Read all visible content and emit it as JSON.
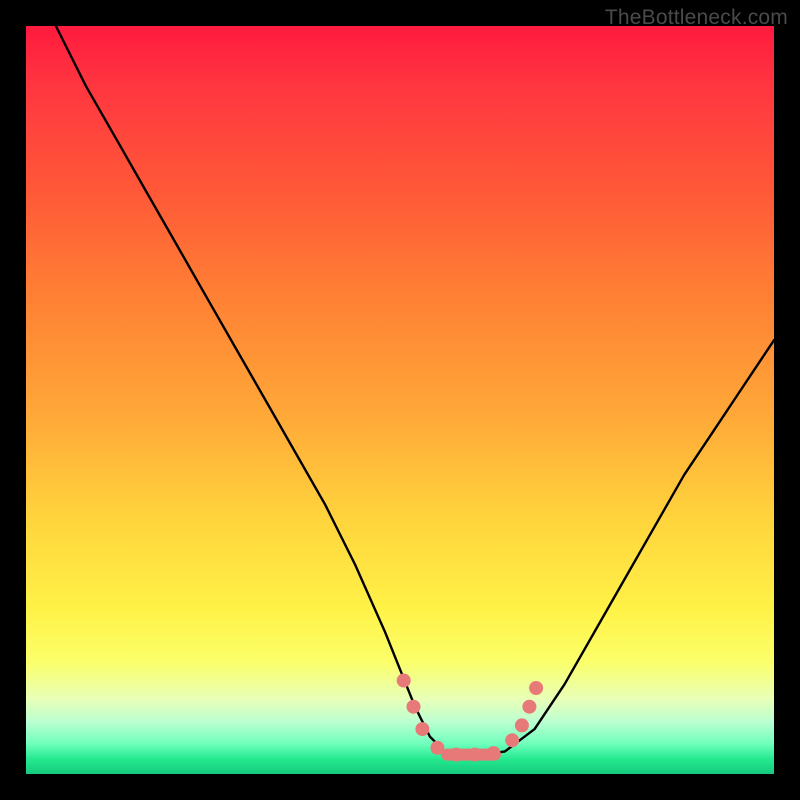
{
  "watermark": "TheBottleneck.com",
  "colors": {
    "frame": "#000000",
    "curve": "#000000",
    "marker": "#e77a78",
    "gradient_top": "#ff1a3e",
    "gradient_bottom": "#16c97d"
  },
  "chart_data": {
    "type": "line",
    "title": "",
    "xlabel": "",
    "ylabel": "",
    "xlim": [
      0,
      100
    ],
    "ylim": [
      0,
      100
    ],
    "grid": false,
    "legend": false,
    "note": "Axes are unitless; values estimated from pixel positions. y = 0 is the bottom (green) edge, y = 100 is the top (red) edge. x = 0 is the left edge.",
    "series": [
      {
        "name": "bottleneck-curve",
        "x": [
          4,
          8,
          12,
          16,
          20,
          24,
          28,
          32,
          36,
          40,
          44,
          48,
          50,
          52,
          54,
          56,
          58,
          60,
          64,
          68,
          72,
          76,
          80,
          84,
          88,
          92,
          96,
          100
        ],
        "y": [
          100,
          92,
          85,
          78,
          71,
          64,
          57,
          50,
          43,
          36,
          28,
          19,
          14,
          9,
          5,
          3,
          2.5,
          2.5,
          3,
          6,
          12,
          19,
          26,
          33,
          40,
          46,
          52,
          58
        ]
      }
    ],
    "markers": {
      "name": "highlight-markers",
      "points": [
        {
          "x": 50.5,
          "y": 12.5
        },
        {
          "x": 51.8,
          "y": 9.0
        },
        {
          "x": 53.0,
          "y": 6.0
        },
        {
          "x": 55.0,
          "y": 3.5
        },
        {
          "x": 57.5,
          "y": 2.6
        },
        {
          "x": 60.0,
          "y": 2.6
        },
        {
          "x": 62.5,
          "y": 2.8
        },
        {
          "x": 65.0,
          "y": 4.5
        },
        {
          "x": 66.3,
          "y": 6.5
        },
        {
          "x": 67.3,
          "y": 9.0
        },
        {
          "x": 68.2,
          "y": 11.5
        }
      ],
      "bottom_pill": {
        "x_start": 55.5,
        "x_end": 63.5,
        "y": 2.6,
        "thickness_y": 1.6
      }
    }
  }
}
